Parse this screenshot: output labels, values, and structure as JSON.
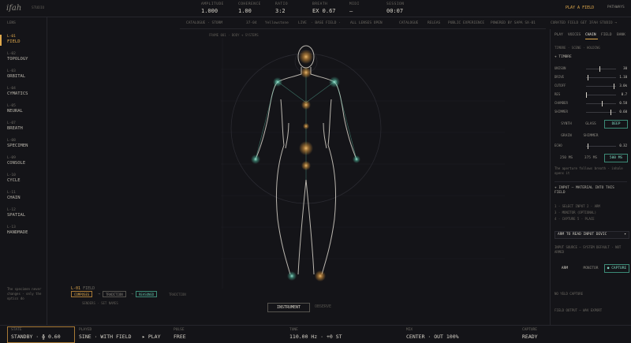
{
  "header": {
    "logo": "ifah",
    "logo_sub": "STUDIO",
    "metrics": [
      {
        "label": "AMPLITUDE",
        "value": "1.000"
      },
      {
        "label": "COHERENCE",
        "value": "1.00"
      },
      {
        "label": "RATIO",
        "value": "3:2"
      },
      {
        "label": "BREATH",
        "value": "EX 0.67"
      },
      {
        "label": "MIDI",
        "value": "—"
      },
      {
        "label": "SESSION",
        "value": "00:07"
      }
    ],
    "play_field": "PLAY A FIELD",
    "pathways": "PATHWAYS"
  },
  "sidebar": {
    "title": "LENS",
    "items": [
      {
        "code": "L-01",
        "name": "FIELD"
      },
      {
        "code": "L-02",
        "name": "TOPOLOGY"
      },
      {
        "code": "L-03",
        "name": "ORBITAL"
      },
      {
        "code": "L-04",
        "name": "CYMATICS"
      },
      {
        "code": "L-05",
        "name": "NEURAL"
      },
      {
        "code": "L-07",
        "name": "BREATH"
      },
      {
        "code": "L-08",
        "name": "SPECIMEN"
      },
      {
        "code": "L-09",
        "name": "CONSOLE"
      },
      {
        "code": "L-10",
        "name": "CYCLE"
      },
      {
        "code": "L-11",
        "name": "CHAIN"
      },
      {
        "code": "L-12",
        "name": "SPATIAL"
      },
      {
        "code": "L-13",
        "name": "HANDMADE"
      }
    ],
    "note": "The specimen never changes - only the optics do"
  },
  "tabbar": {
    "catalogue": "CATALOGUE · STORM",
    "count": "37·04",
    "collection": "Yellowstone",
    "live": "LIVE",
    "base": "· BASE FIELD ·",
    "all_lenses": "ALL LENSES OPEN",
    "catalogue2": "CATALOGUE",
    "releas": "RELEAS",
    "experience": "PUBLIC EXPERIENCE",
    "powered": "POWERED BY SAPA SX-01",
    "curated": "CURATED FIELD",
    "get": "GET IFAH STUDIO →"
  },
  "figure": {
    "caption": "FRAME 001 · BODY + SYSTEMS",
    "field_code": "L-01",
    "field_label": "FIELD",
    "chips": [
      "COMPOSES",
      "TRADITION",
      "REASONED"
    ],
    "arrow": "→",
    "tradition": "TRADITION",
    "composes": "SENDERS · SET NAMES",
    "instrument_btn": "INSTRUMENT",
    "observe_btn": "OBSERVE"
  },
  "rpanel": {
    "tabs": [
      "PLAY",
      "VOICES",
      "CHAIN",
      "FIELD",
      "BANK"
    ],
    "subtabs": "TIMBRE · SCENE · HOLDING",
    "timbre_title": "+ TIMBRE",
    "sliders": [
      {
        "label": "UNISON",
        "value": "30",
        "pos": 0.45
      },
      {
        "label": "DRIVE",
        "value": "1.10",
        "pos": 0.05
      },
      {
        "label": "CUTOFF",
        "value": "3.0k",
        "pos": 0.95
      },
      {
        "label": "RES",
        "value": "0.7",
        "pos": 0.0
      },
      {
        "label": "CHAMBER",
        "value": "0.58",
        "pos": 0.55
      },
      {
        "label": "SHIMMER",
        "value": "0.60",
        "pos": 0.85
      }
    ],
    "modes1": [
      "SYNTH",
      "GLASS",
      "DEEP"
    ],
    "modes2": [
      "GRAIN",
      "SHIMMER"
    ],
    "echo": {
      "label": "ECHO",
      "value": "0.32",
      "pos": 0.05
    },
    "times": [
      "250 MS",
      "375 MS",
      "500 MS"
    ],
    "echo_note": "The aperture follows breath - inhale opens it",
    "input_title": "+ INPUT — MATERIAL INTO THIS FIELD",
    "steps": [
      "1 · SELECT INPUT 2 · ARM",
      "3 · MONITOR (OPTIONAL)",
      "4 · CAPTURE 5 · PLACE"
    ],
    "arm_select": "ARM TO READ INPUT DEVIC",
    "input_source": "INPUT SOURCE — SYSTEM DEFAULT · NOT ARMED",
    "arm": "ARM",
    "monitor": "MONITOR",
    "capture": "● CAPTURE",
    "no_capture": "NO YELD CAPTURE",
    "field_output": "FIELD OUTPUT — WAV EXPORT"
  },
  "footer": {
    "state_label": "STATE",
    "state_value": "STANDBY · ɸ 0.60",
    "played_label": "PLAYED",
    "played_value": "SINE · WITH FIELD",
    "play_btn": "▸ PLAY",
    "pulse_label": "PULSE",
    "pulse_value": "FREE",
    "tune_label": "TUNE",
    "tune_value": "110.00 Hz · +0 ST",
    "mix_label": "MIX",
    "mix_value": "CENTER · OUT 100%",
    "capture_label": "CAPTURE",
    "capture_value": "READY"
  },
  "colors": {
    "accent": "#e0a94c",
    "teal": "#5fc2a8",
    "bg": "#141418"
  }
}
